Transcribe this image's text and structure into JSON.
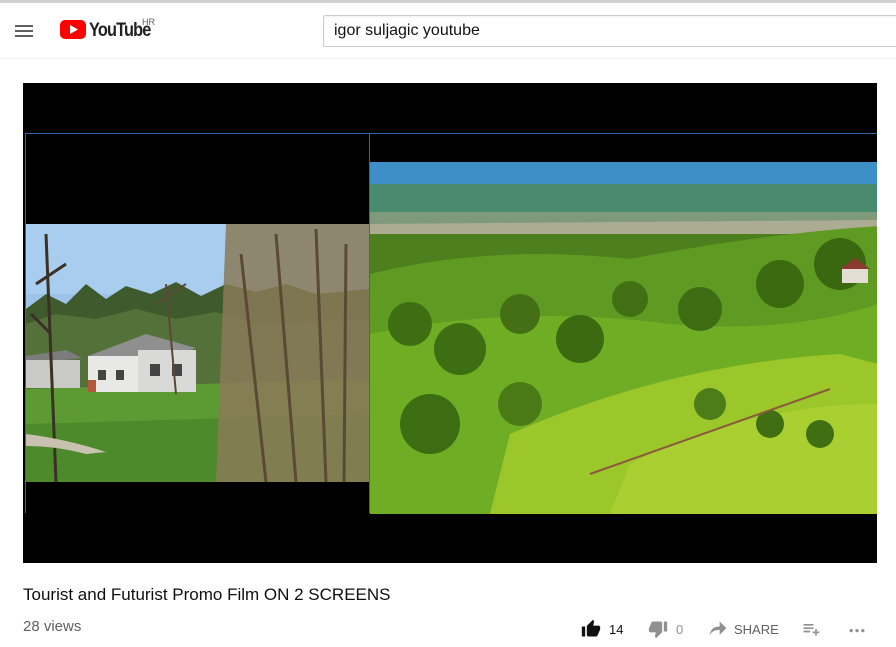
{
  "masthead": {
    "logo_text": "YouTube",
    "region": "HR",
    "search_value": "igor suljagic youtube"
  },
  "video": {
    "title": "Tourist and Futurist Promo Film ON 2 SCREENS",
    "views": "28 views",
    "likes": "14",
    "dislikes": "0",
    "share_label": "SHARE"
  },
  "colors": {
    "brand_red": "#ff0000",
    "icon_gray": "#909090",
    "text_dark": "#0f0f0f",
    "text_gray": "#606060"
  },
  "icons": [
    "menu-icon",
    "youtube-logo-icon",
    "like-icon",
    "dislike-icon",
    "share-icon",
    "add-to-playlist-icon",
    "more-icon"
  ]
}
